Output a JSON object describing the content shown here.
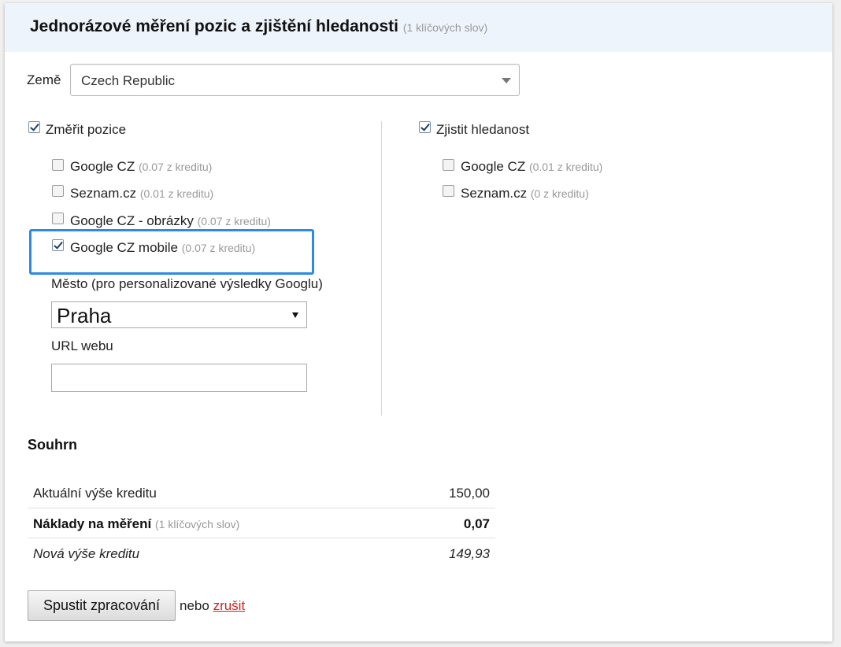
{
  "header": {
    "title": "Jednorázové měření pozic a zjištění hledanosti",
    "subtitle": "(1 klíčových slov)"
  },
  "country": {
    "label": "Země",
    "selected": "Czech Republic"
  },
  "positions": {
    "label": "Změřit pozice",
    "checked": true,
    "engines": [
      {
        "label": "Google CZ",
        "cost": "(0.07 z kreditu)",
        "checked": false
      },
      {
        "label": "Seznam.cz",
        "cost": "(0.01 z kreditu)",
        "checked": false
      },
      {
        "label": "Google CZ - obrázky",
        "cost": "(0.07 z kreditu)",
        "checked": false
      },
      {
        "label": "Google CZ mobile",
        "cost": "(0.07 z kreditu)",
        "checked": true
      }
    ],
    "city_label": "Město (pro personalizované výsledky Googlu)",
    "city_selected": "Praha",
    "url_label": "URL webu",
    "url_value": ""
  },
  "searchVolume": {
    "label": "Zjistit hledanost",
    "checked": true,
    "engines": [
      {
        "label": "Google CZ",
        "cost": "(0.01 z kreditu)",
        "checked": false
      },
      {
        "label": "Seznam.cz",
        "cost": "(0 z kreditu)",
        "checked": false
      }
    ]
  },
  "summary": {
    "title": "Souhrn",
    "rows": [
      {
        "label": "Aktuální výše kreditu",
        "note": "",
        "value": "150,00"
      },
      {
        "label": "Náklady na měření",
        "note": "(1 klíčových slov)",
        "value": "0,07"
      },
      {
        "label": "Nová výše kreditu",
        "note": "",
        "value": "149,93"
      }
    ]
  },
  "actions": {
    "run_label": "Spustit zpracování",
    "or_text": "nebo",
    "cancel_label": "zrušit"
  },
  "colors": {
    "highlight": "#2b8ae6",
    "cancel_link": "#d21f1f",
    "header_bg": "#eef4fb"
  }
}
